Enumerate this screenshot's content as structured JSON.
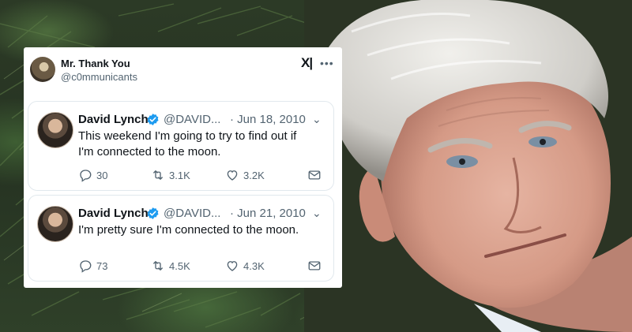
{
  "post": {
    "author_name": "Mr. Thank You",
    "author_handle": "@c0mmunicants",
    "x_icon": "x-logo-icon",
    "more_icon": "more-horizontal-icon"
  },
  "tweets": [
    {
      "name": "David Lynch",
      "handle": "@DAVID...",
      "date": "· Jun 18, 2010",
      "text": "This weekend I'm going to try to find out if I'm connected to the moon.",
      "replies": "30",
      "retweets": "3.1K",
      "likes": "3.2K"
    },
    {
      "name": "David Lynch",
      "handle": "@DAVID...",
      "date": "· Jun 21, 2010",
      "text": "I'm pretty sure I'm connected to the moon.",
      "replies": "73",
      "retweets": "4.5K",
      "likes": "4.3K"
    }
  ],
  "colors": {
    "verified": "#1d9bf0",
    "text_primary": "#0f1419",
    "text_secondary": "#536471"
  }
}
